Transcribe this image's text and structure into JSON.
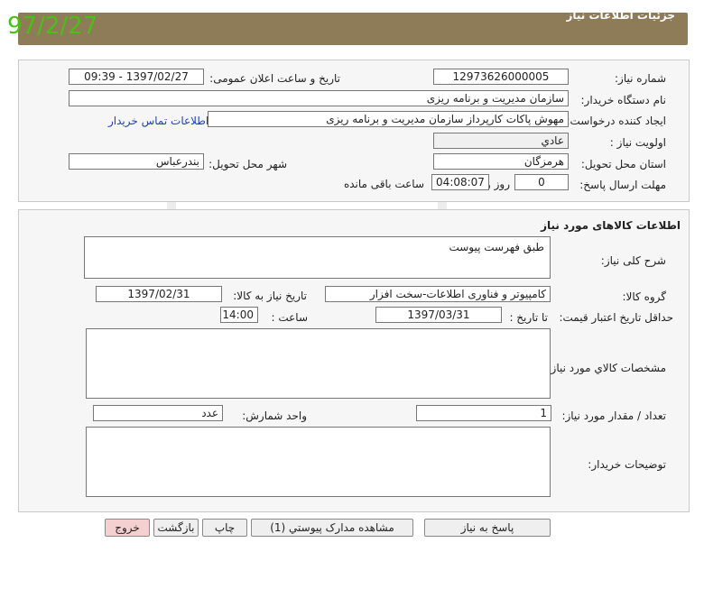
{
  "stamp": "97/2/27",
  "header": {
    "title": "جزئیات اطلاعات نیاز"
  },
  "info": {
    "need_number_label": "شماره نیاز:",
    "need_number": "12973626000005",
    "announce_label": "تاریخ و ساعت اعلان عمومی:",
    "announce_value": "1397/02/27 - 09:39",
    "buyer_org_label": "نام دستگاه خریدار:",
    "buyer_org": "سازمان مدیریت و برنامه ریزی",
    "creator_label": "ایجاد کننده درخواست:",
    "creator": "مهوش پاکات کارپرداز سازمان مدیریت و برنامه ریزی",
    "contact_link": "اطلاعات تماس خریدار",
    "priority_label": "اولویت نیاز :",
    "priority": "عادي",
    "province_label": "استان محل تحویل:",
    "province": "هرمزگان",
    "city_label": "شهر محل تحویل:",
    "city": "بندرعباس",
    "deadline_label": "مهلت ارسال پاسخ:",
    "days": "0",
    "days_suffix": "روز و",
    "time_left": "04:08:07",
    "time_left_suffix": "ساعت باقی مانده"
  },
  "goods": {
    "section_title": "اطلاعات کالاهای مورد نیاز",
    "description_label": "شرح کلی نیاز:",
    "description": "طبق فهرست پیوست",
    "group_label": "گروه کالا:",
    "group": "کامپیوتر و فناوری اطلاعات-سخت افزار",
    "need_date_label": "تاریخ نیاز به کالا:",
    "need_date": "1397/02/31",
    "min_price_label": "حداقل تاریخ اعتبار قیمت:",
    "until_date_label": "تا تاریخ :",
    "until_date": "1397/03/31",
    "time_label": "ساعت :",
    "time": "14:00",
    "specs_label": "مشخصات کالاي مورد نیاز:",
    "specs": "",
    "qty_label": "تعداد / مقدار مورد نیاز:",
    "qty": "1",
    "unit_label": "واحد شمارش:",
    "unit": "عدد",
    "buyer_notes_label": "توضیحات خریدار:",
    "buyer_notes": ""
  },
  "buttons": {
    "reply": "پاسخ به نیاز",
    "view_docs": "مشاهده مدارک پیوستي (1)",
    "print": "چاپ",
    "back": "بازگشت",
    "exit": "خروج"
  }
}
